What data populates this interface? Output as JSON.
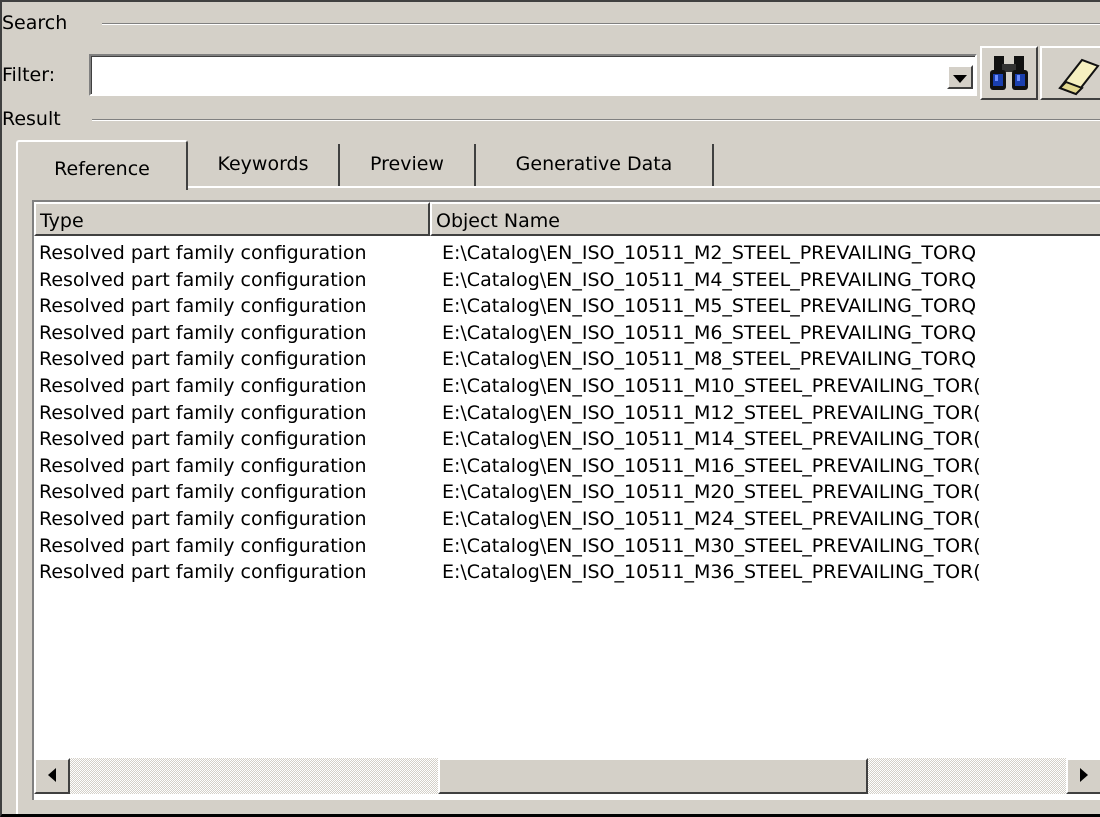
{
  "search": {
    "group_label": "Search",
    "filter_label": "Filter:",
    "filter_value": ""
  },
  "result": {
    "group_label": "Result",
    "tabs": [
      {
        "label": "Reference",
        "active": true
      },
      {
        "label": "Keywords",
        "active": false
      },
      {
        "label": "Preview",
        "active": false
      },
      {
        "label": "Generative Data",
        "active": false
      }
    ],
    "columns": [
      "Type",
      "Object Name"
    ],
    "rows": [
      [
        "Resolved part family configuration",
        "E:\\Catalog\\EN_ISO_10511_M2_STEEL_PREVAILING_TORQ"
      ],
      [
        "Resolved part family configuration",
        "E:\\Catalog\\EN_ISO_10511_M4_STEEL_PREVAILING_TORQ"
      ],
      [
        "Resolved part family configuration",
        "E:\\Catalog\\EN_ISO_10511_M5_STEEL_PREVAILING_TORQ"
      ],
      [
        "Resolved part family configuration",
        "E:\\Catalog\\EN_ISO_10511_M6_STEEL_PREVAILING_TORQ"
      ],
      [
        "Resolved part family configuration",
        "E:\\Catalog\\EN_ISO_10511_M8_STEEL_PREVAILING_TORQ"
      ],
      [
        "Resolved part family configuration",
        "E:\\Catalog\\EN_ISO_10511_M10_STEEL_PREVAILING_TOR("
      ],
      [
        "Resolved part family configuration",
        "E:\\Catalog\\EN_ISO_10511_M12_STEEL_PREVAILING_TOR("
      ],
      [
        "Resolved part family configuration",
        "E:\\Catalog\\EN_ISO_10511_M14_STEEL_PREVAILING_TOR("
      ],
      [
        "Resolved part family configuration",
        "E:\\Catalog\\EN_ISO_10511_M16_STEEL_PREVAILING_TOR("
      ],
      [
        "Resolved part family configuration",
        "E:\\Catalog\\EN_ISO_10511_M20_STEEL_PREVAILING_TOR("
      ],
      [
        "Resolved part family configuration",
        "E:\\Catalog\\EN_ISO_10511_M24_STEEL_PREVAILING_TOR("
      ],
      [
        "Resolved part family configuration",
        "E:\\Catalog\\EN_ISO_10511_M30_STEEL_PREVAILING_TOR("
      ],
      [
        "Resolved part family configuration",
        "E:\\Catalog\\EN_ISO_10511_M36_STEEL_PREVAILING_TOR("
      ]
    ]
  },
  "icons": {
    "search": "binoculars-icon",
    "clear": "eraser-icon",
    "dropdown": "triangle-down-icon"
  },
  "colors": {
    "face": "#d4d0c8",
    "list_bg": "#ffffff"
  }
}
